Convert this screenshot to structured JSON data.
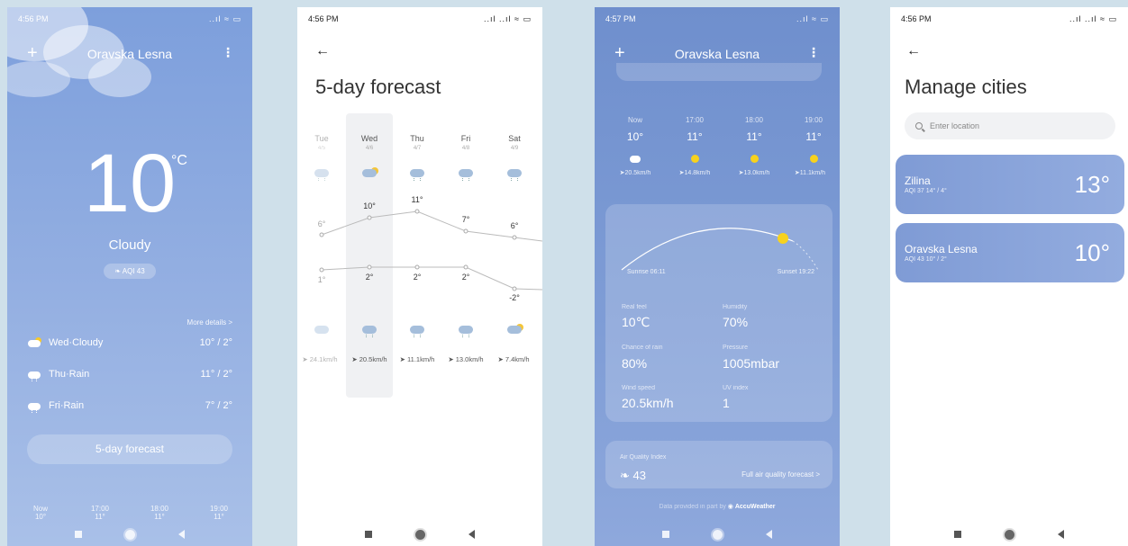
{
  "panel1": {
    "status_time": "4:56 PM",
    "status_right": "..ıl ≈ ▭",
    "city": "Oravska Lesna",
    "temperature": "10",
    "unit": "°C",
    "condition": "Cloudy",
    "aqi": "AQI 43",
    "more_details": "More details >",
    "forecast_rows": [
      {
        "label": "Wed·Cloudy",
        "temps": "10° / 2°",
        "icon": "cloud-sun-icon"
      },
      {
        "label": "Thu·Rain",
        "temps": "11° / 2°",
        "icon": "rain-icon"
      },
      {
        "label": "Fri·Rain",
        "temps": "7° / 2°",
        "icon": "rain-icon"
      }
    ],
    "forecast_button": "5-day forecast",
    "hourly": [
      {
        "time": "Now",
        "temp": "10°"
      },
      {
        "time": "17:00",
        "temp": "11°"
      },
      {
        "time": "18:00",
        "temp": "11°"
      },
      {
        "time": "19:00",
        "temp": "11°"
      }
    ]
  },
  "panel2": {
    "status_time": "4:56 PM",
    "status_right": "..ıl ..ıl ≈ ▭",
    "title": "5-day forecast",
    "days": [
      {
        "day": "Tue",
        "date": "4/5",
        "high": "6°",
        "low": "1°",
        "wind": "24.1km/h"
      },
      {
        "day": "Wed",
        "date": "4/6",
        "high": "10°",
        "low": "2°",
        "wind": "20.5km/h"
      },
      {
        "day": "Thu",
        "date": "4/7",
        "high": "11°",
        "low": "2°",
        "wind": "11.1km/h"
      },
      {
        "day": "Fri",
        "date": "4/8",
        "high": "7°",
        "low": "2°",
        "wind": "13.0km/h"
      },
      {
        "day": "Sat",
        "date": "4/9",
        "high": "6°",
        "low": "-2°",
        "wind": "7.4km/h"
      }
    ]
  },
  "panel3": {
    "status_time": "4:57 PM",
    "status_right": "..ıl ≈ ▭",
    "city": "Oravska Lesna",
    "hourly": [
      {
        "time": "Now",
        "temp": "10°",
        "wind": "20.5km/h"
      },
      {
        "time": "17:00",
        "temp": "11°",
        "wind": "14.8km/h"
      },
      {
        "time": "18:00",
        "temp": "11°",
        "wind": "13.0km/h"
      },
      {
        "time": "19:00",
        "temp": "11°",
        "wind": "11.1km/h"
      }
    ],
    "sunrise": "Sunrise 06:11",
    "sunset": "Sunset 19:22",
    "details": [
      {
        "label": "Real feel",
        "value": "10℃"
      },
      {
        "label": "Humidity",
        "value": "70%"
      },
      {
        "label": "Chance of rain",
        "value": "80%"
      },
      {
        "label": "Pressure",
        "value": "1005mbar"
      },
      {
        "label": "Wind speed",
        "value": "20.5km/h"
      },
      {
        "label": "UV index",
        "value": "1"
      }
    ],
    "aqi_label": "Air Quality Index",
    "aqi_value": "43",
    "aqi_link": "Full air quality forecast >",
    "provider_prefix": "Data provided in part by",
    "provider": "AccuWeather"
  },
  "panel4": {
    "status_time": "4:56 PM",
    "status_right": "..ıl ..ıl ≈ ▭",
    "title": "Manage cities",
    "search_placeholder": "Enter location",
    "cities": [
      {
        "name": "Zilina",
        "aqi": "AQI 37  14° / 4°",
        "temp": "13°"
      },
      {
        "name": "Oravska Lesna",
        "aqi": "AQI 43  10° / 2°",
        "temp": "10°"
      }
    ]
  }
}
